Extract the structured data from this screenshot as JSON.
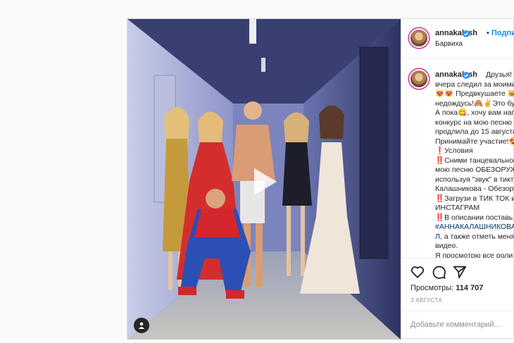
{
  "post": {
    "username": "annakalash",
    "follow_label": "Подписаться",
    "location": "Барвиха",
    "verified_icon": "verified-badge-icon"
  },
  "caption": {
    "username": "annakalash",
    "lines": [
      "Друзья! Кто",
      "вчера следил за моими",
      "😻😻 Предвкушаете 🐱",
      "недождусь!🙈✌️Это буде",
      "А пока😋, хочу вам напом",
      "конкурс на мою песню",
      "продлила до 15 августа",
      "Принимайте участие!😍",
      "❗Условия",
      "‼️Сними танцевальное в",
      "мою песню ОБЕЗОРУЖЕ",
      "используя \"звук\" в тикт",
      "Калашникова - Обезоруж",
      "‼️Загрузи в ТИК ТОК или",
      "ИНСТАГРАМ",
      "‼️В описании поставь х"
    ],
    "hashtag_line_1": "#АННАКАЛАШНИКОВАОБЕЗ",
    "hashtag_line_2": "Л",
    "hashtag_suffix": ", а также отметь меня",
    "lines_after": [
      "видео.",
      "Я просмотрю все роли"
    ]
  },
  "actions": {
    "like_icon": "heart-icon",
    "comment_icon": "comment-icon",
    "share_icon": "share-icon",
    "views_label": "Просмотры:",
    "views_count": "114 707",
    "date": "3 АВГУСТА"
  },
  "comment": {
    "placeholder": "Добавьте комментарий..."
  },
  "media": {
    "play_icon": "play-icon",
    "tagged_user_icon": "user-tag-icon"
  }
}
